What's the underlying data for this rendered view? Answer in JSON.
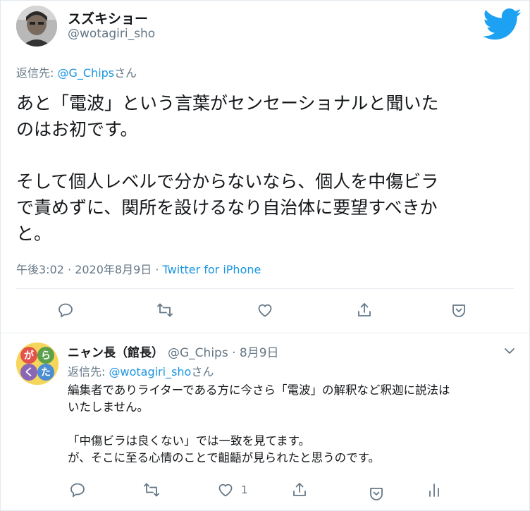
{
  "tweet": {
    "display_name": "スズキショー",
    "handle": "@wotagiri_sho",
    "reply_prefix": "返信先: ",
    "reply_mention": "@G_Chips",
    "reply_suffix": "さん",
    "text": "あと「電波」という言葉がセンセーショナルと聞いた\nのはお初です。\n\nそして個人レベルで分からないなら、個人を中傷ビラ\nで責めずに、関所を設けるなり自治体に要望すべきか\nと。",
    "timestamp": "午後3:02 · 2020年8月9日 · ",
    "source": "Twitter for iPhone",
    "actions": [
      "reply-icon",
      "retweet-icon",
      "like-icon",
      "share-icon",
      "bookmark-icon"
    ]
  },
  "reply": {
    "display_name": "ニャン長（館長）",
    "handle": "@G_Chips",
    "date": " · 8月9日",
    "reply_prefix": "返信先: ",
    "reply_mention": "@wotagiri_sho",
    "reply_suffix": "さん",
    "text": "編集者でありライターである方に今さら「電波」の解釈など釈迦に説法は\nいたしません。\n\n「中傷ビラは良くない」では一致を見てます。\nが、そこに至る心情のことで齟齬が見られたと思うのです。",
    "like_count": "1",
    "avatar_chars": [
      "が",
      "ら",
      "く",
      "た"
    ],
    "actions": [
      "reply-icon",
      "retweet-icon",
      "like-icon",
      "share-icon",
      "bookmark-icon",
      "analytics-icon"
    ]
  },
  "colors": {
    "accent": "#1da1f2",
    "link": "#1b95e0",
    "muted": "#657786",
    "text": "#14171a",
    "divider": "#e6ecf0"
  }
}
